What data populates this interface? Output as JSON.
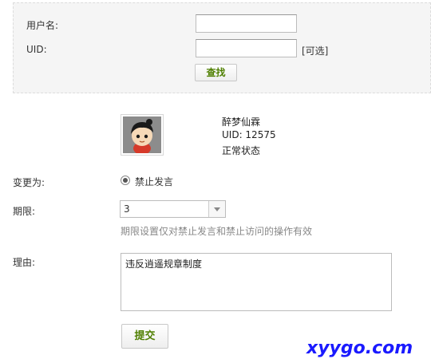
{
  "search": {
    "username_label": "用户名:",
    "username_value": "",
    "uid_label": "UID:",
    "uid_value": "",
    "uid_optional": "[可选]",
    "search_button": "查找"
  },
  "user": {
    "name": "醉梦仙霖",
    "uid": "UID: 12575",
    "status": "正常状态"
  },
  "form": {
    "change_to_label": "变更为:",
    "change_option": "禁止发言",
    "period_label": "期限:",
    "period_value": "3",
    "period_hint": "期限设置仅对禁止发言和禁止访问的操作有效",
    "reason_label": "理由:",
    "reason_value": "违反逍遥规章制度",
    "submit_button": "提交"
  },
  "watermark": "xyygo.com"
}
